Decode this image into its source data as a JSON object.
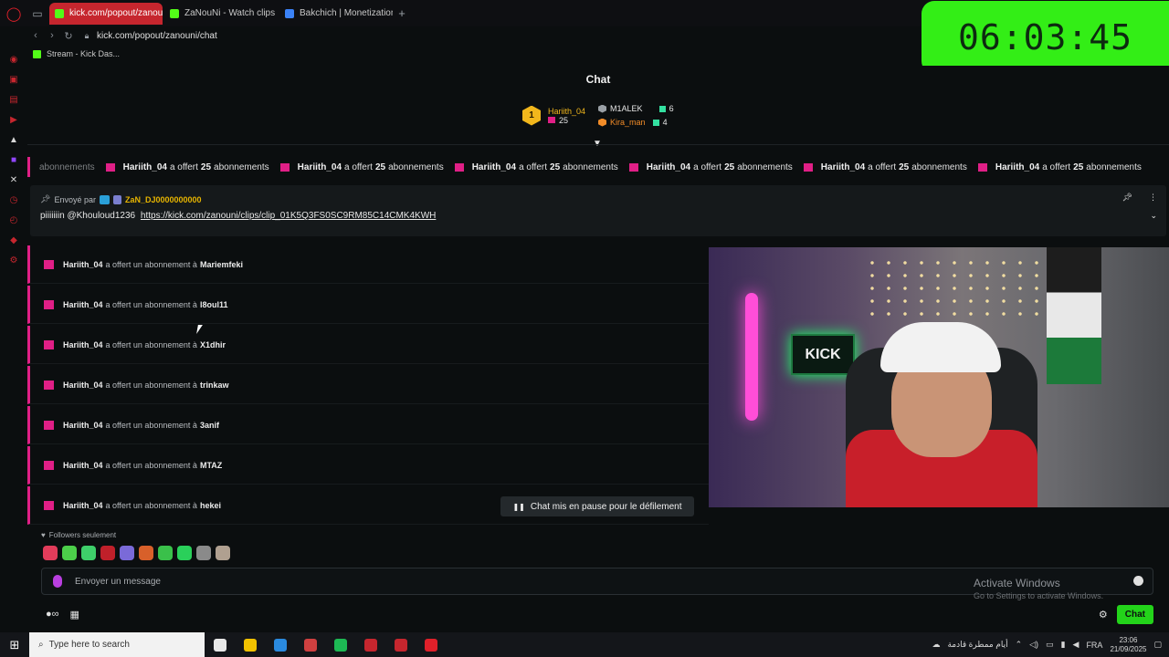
{
  "browser": {
    "tabs": [
      {
        "label": "kick.com/popout/zanouni",
        "active": true,
        "favicon_color": "#53fc18"
      },
      {
        "label": "ZaNouNi - Watch clips on",
        "active": false,
        "favicon_color": "#53fc18"
      },
      {
        "label": "Bakchich | Monetization f",
        "active": false,
        "favicon_color": "#3b82f6"
      }
    ],
    "url": "kick.com/popout/zanouni/chat",
    "bookmark": "Stream - Kick Das..."
  },
  "timer": "06:03:45",
  "chat": {
    "title": "Chat",
    "leaderboard": {
      "first": {
        "rank": "1",
        "name": "Hariith_04",
        "count": "25"
      },
      "second": {
        "name": "M1ALEK",
        "count": "6"
      },
      "third": {
        "name": "Kira_man",
        "count": "4"
      }
    },
    "ticker": {
      "lead": "abonnements",
      "user": "Hariith_04",
      "verb": "a offert",
      "count": "25",
      "noun": "abonnements",
      "repeat": 6
    },
    "pinned": {
      "sent_by": "Envoyé par",
      "user": "ZaN_DJ0000000000",
      "text": "piiiiiiin @Khouloud1236",
      "link": "https://kick.com/zanouni/clips/clip_01K5Q3FS0SC9RM85C14CMK4KWH"
    },
    "message_template": {
      "verb": "a offert un abonnement à"
    },
    "messages": [
      {
        "user": "Hariith_04",
        "recipient": "Mariemfeki"
      },
      {
        "user": "Hariith_04",
        "recipient": "l8oul11"
      },
      {
        "user": "Hariith_04",
        "recipient": "X1dhir"
      },
      {
        "user": "Hariith_04",
        "recipient": "trinkaw"
      },
      {
        "user": "Hariith_04",
        "recipient": "3anif"
      },
      {
        "user": "Hariith_04",
        "recipient": "MTAZ"
      },
      {
        "user": "Hariith_04",
        "recipient": "hekei"
      }
    ],
    "webcam_sign": "KICK",
    "pause_banner": "Chat mis en pause pour le défilement",
    "followers_only": "Followers seulement",
    "emote_colors": [
      "#e23c5a",
      "#4ccf4a",
      "#3ecf6a",
      "#c0202a",
      "#7a6ad8",
      "#d8602a",
      "#3ac04a",
      "#2ad05a",
      "#8a8a8a",
      "#b0a090"
    ],
    "composer_placeholder": "Envoyer un message",
    "chat_button": "Chat",
    "activate_title": "Activate Windows",
    "activate_sub": "Go to Settings to activate Windows."
  },
  "taskbar": {
    "search_placeholder": "Type here to search",
    "weather": "أيام ممطرة قادمة",
    "lang": "FRA",
    "time": "23:06",
    "date": "21/09/2025",
    "app_colors": [
      "#e8e8e8",
      "#f2c200",
      "#2a8adf",
      "#d04040",
      "#1db954",
      "#c6262e",
      "#c6262e",
      "#e0202a"
    ]
  }
}
